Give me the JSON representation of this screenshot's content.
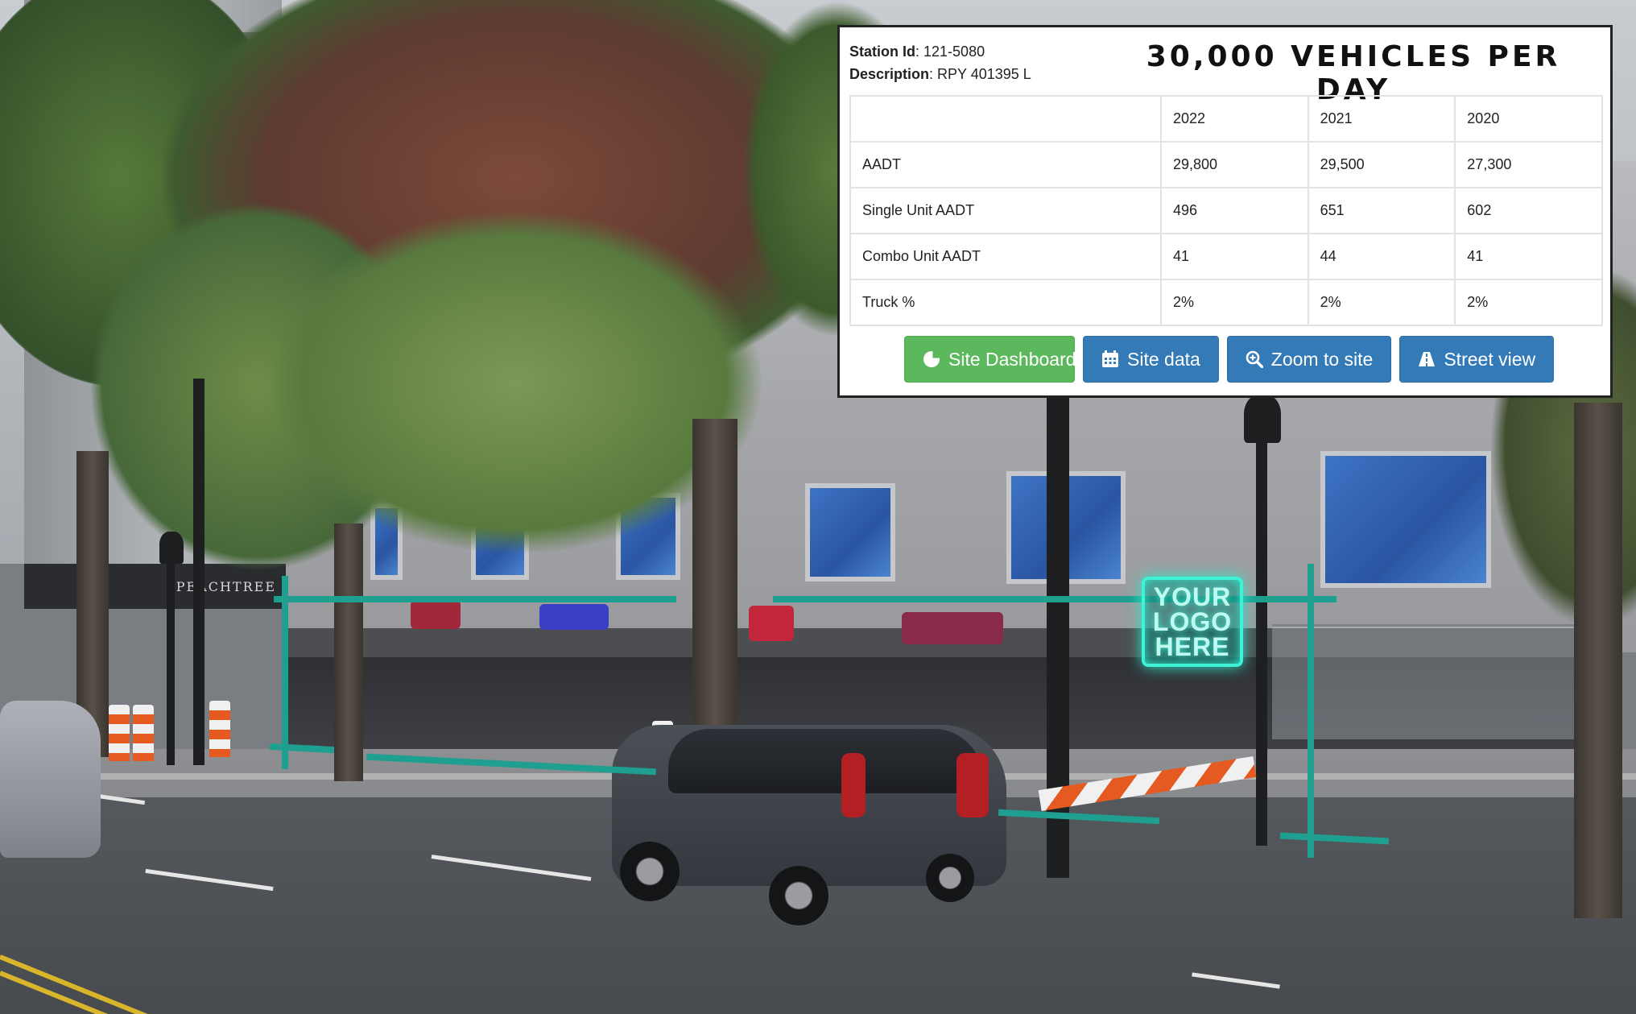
{
  "popup": {
    "station_label": "Station Id",
    "station_value": "121-5080",
    "description_label": "Description",
    "description_value": "RPY 401395 L",
    "headline": "30,000 VEHICLES PER DAY",
    "table": {
      "years": [
        "2022",
        "2021",
        "2020"
      ],
      "rows": [
        {
          "label": "AADT",
          "values": [
            "29,800",
            "29,500",
            "27,300"
          ]
        },
        {
          "label": "Single Unit AADT",
          "values": [
            "496",
            "651",
            "602"
          ]
        },
        {
          "label": "Combo Unit AADT",
          "values": [
            "41",
            "44",
            "41"
          ]
        },
        {
          "label": "Truck %",
          "values": [
            "2%",
            "2%",
            "2%"
          ]
        }
      ]
    },
    "buttons": [
      {
        "label": "Site Dashboard",
        "icon": "pie-chart-icon",
        "color": "#5cb85c"
      },
      {
        "label": "Site data",
        "icon": "calendar-icon",
        "color": "#337ab7"
      },
      {
        "label": "Zoom to site",
        "icon": "zoom-in-icon",
        "color": "#337ab7"
      },
      {
        "label": "Street view",
        "icon": "road-icon",
        "color": "#337ab7"
      }
    ]
  },
  "scene": {
    "logo_sign": [
      "YOUR",
      "LOGO",
      "HERE"
    ],
    "building_sign": "PEACHTREE",
    "highlight_color": "#1f9f8f"
  }
}
